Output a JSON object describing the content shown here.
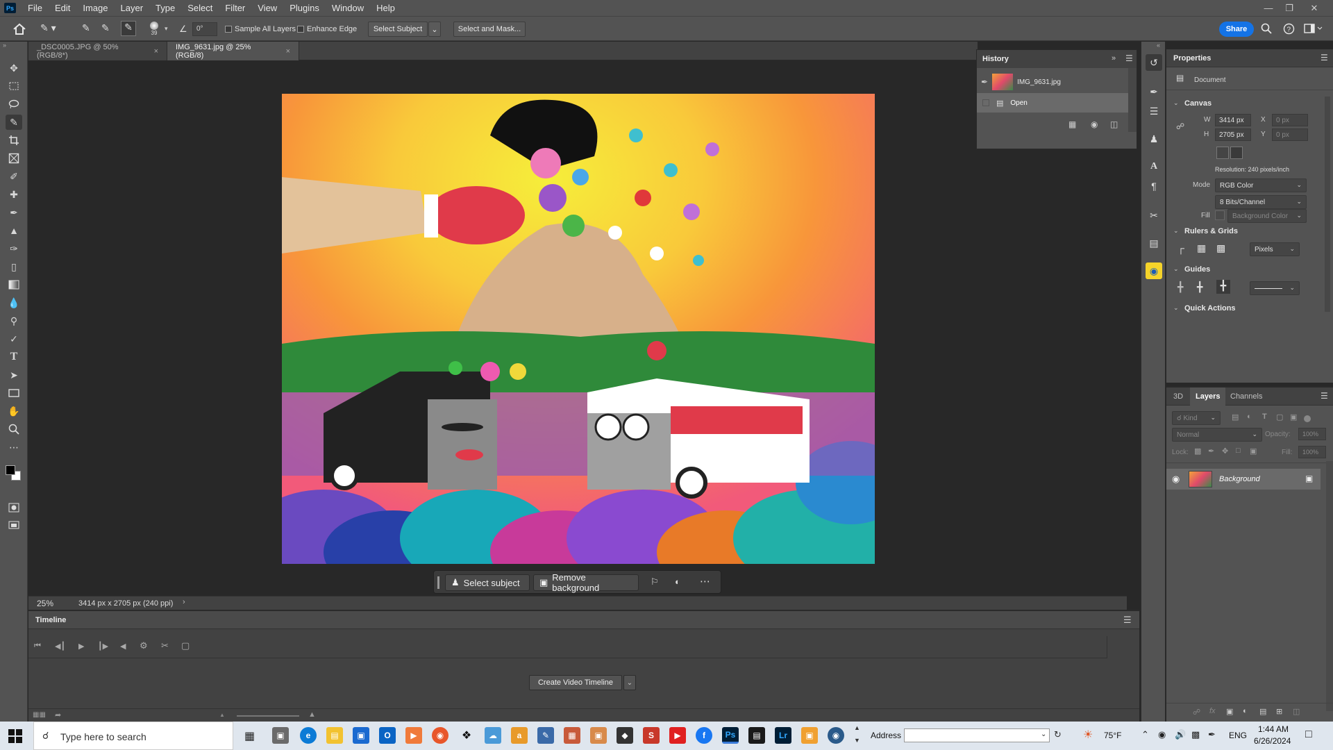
{
  "menu": {
    "items": [
      "File",
      "Edit",
      "Image",
      "Layer",
      "Type",
      "Select",
      "Filter",
      "View",
      "Plugins",
      "Window",
      "Help"
    ]
  },
  "options": {
    "brush_size": "39",
    "angle": "0°",
    "sample_all_layers": "Sample All Layers",
    "enhance_edge": "Enhance Edge",
    "select_subject": "Select Subject",
    "select_and_mask": "Select and Mask...",
    "share": "Share"
  },
  "tabs": [
    {
      "label": "_DSC0005.JPG @ 50% (RGB/8*)"
    },
    {
      "label": "IMG_9631.jpg @ 25% (RGB/8)"
    }
  ],
  "context_bar": {
    "select_subject": "Select subject",
    "remove_background": "Remove background"
  },
  "status": {
    "zoom": "25%",
    "doc_info": "3414 px x 2705 px (240 ppi)"
  },
  "timeline": {
    "title": "Timeline",
    "create_button": "Create Video Timeline"
  },
  "history": {
    "title": "History",
    "snapshot": "IMG_9631.jpg",
    "steps": [
      "Open"
    ]
  },
  "properties": {
    "title": "Properties",
    "document_label": "Document",
    "canvas_title": "Canvas",
    "w_label": "W",
    "w_value": "3414 px",
    "h_label": "H",
    "h_value": "2705 px",
    "x_label": "X",
    "x_value": "0 px",
    "y_label": "Y",
    "y_value": "0 px",
    "resolution": "Resolution: 240 pixels/inch",
    "mode_label": "Mode",
    "mode_value": "RGB Color",
    "bits_value": "8 Bits/Channel",
    "fill_label": "Fill",
    "fill_value": "Background Color",
    "rulers_title": "Rulers & Grids",
    "units_value": "Pixels",
    "guides_title": "Guides",
    "quick_actions_title": "Quick Actions"
  },
  "layers": {
    "tabs": [
      "3D",
      "Layers",
      "Channels"
    ],
    "kind_placeholder": "Kind",
    "blend_mode": "Normal",
    "opacity_label": "Opacity:",
    "opacity_value": "100%",
    "lock_label": "Lock:",
    "fill_label": "Fill:",
    "fill_value": "100%",
    "layer_name": "Background"
  },
  "taskbar": {
    "search_placeholder": "Type here to search",
    "address_label": "Address",
    "weather": "75°F",
    "language": "ENG",
    "time": "1:44 AM",
    "date": "6/26/2024"
  },
  "colors": {
    "accent": "#1473e6",
    "panel": "#535353",
    "panel_dark": "#424242",
    "canvas_bg": "#282828"
  }
}
